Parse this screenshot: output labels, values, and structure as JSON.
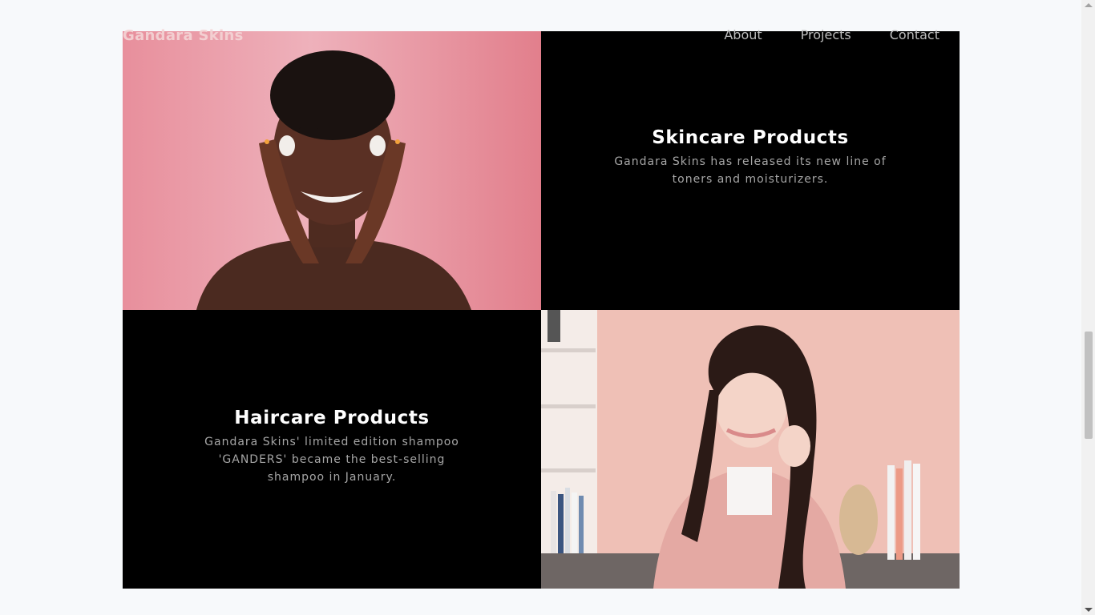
{
  "header": {
    "brand": "Gandara Skins",
    "nav": [
      "About",
      "Projects",
      "Contact"
    ]
  },
  "sections": {
    "skincare": {
      "title": "Skincare Products",
      "description": "Gandara Skins has released its new line of toners and moisturizers."
    },
    "haircare": {
      "title": "Haircare Products",
      "description": "Gandara Skins' limited edition shampoo 'GANDERS' became the best-selling shampoo in January."
    }
  },
  "colors": {
    "page_background": "#f7f9fb",
    "panel_background": "#000000",
    "heading": "#ffffff",
    "body_text": "#a6a6a6",
    "photo1_background": "#e39aa5",
    "photo2_background": "#f0c1b8"
  }
}
